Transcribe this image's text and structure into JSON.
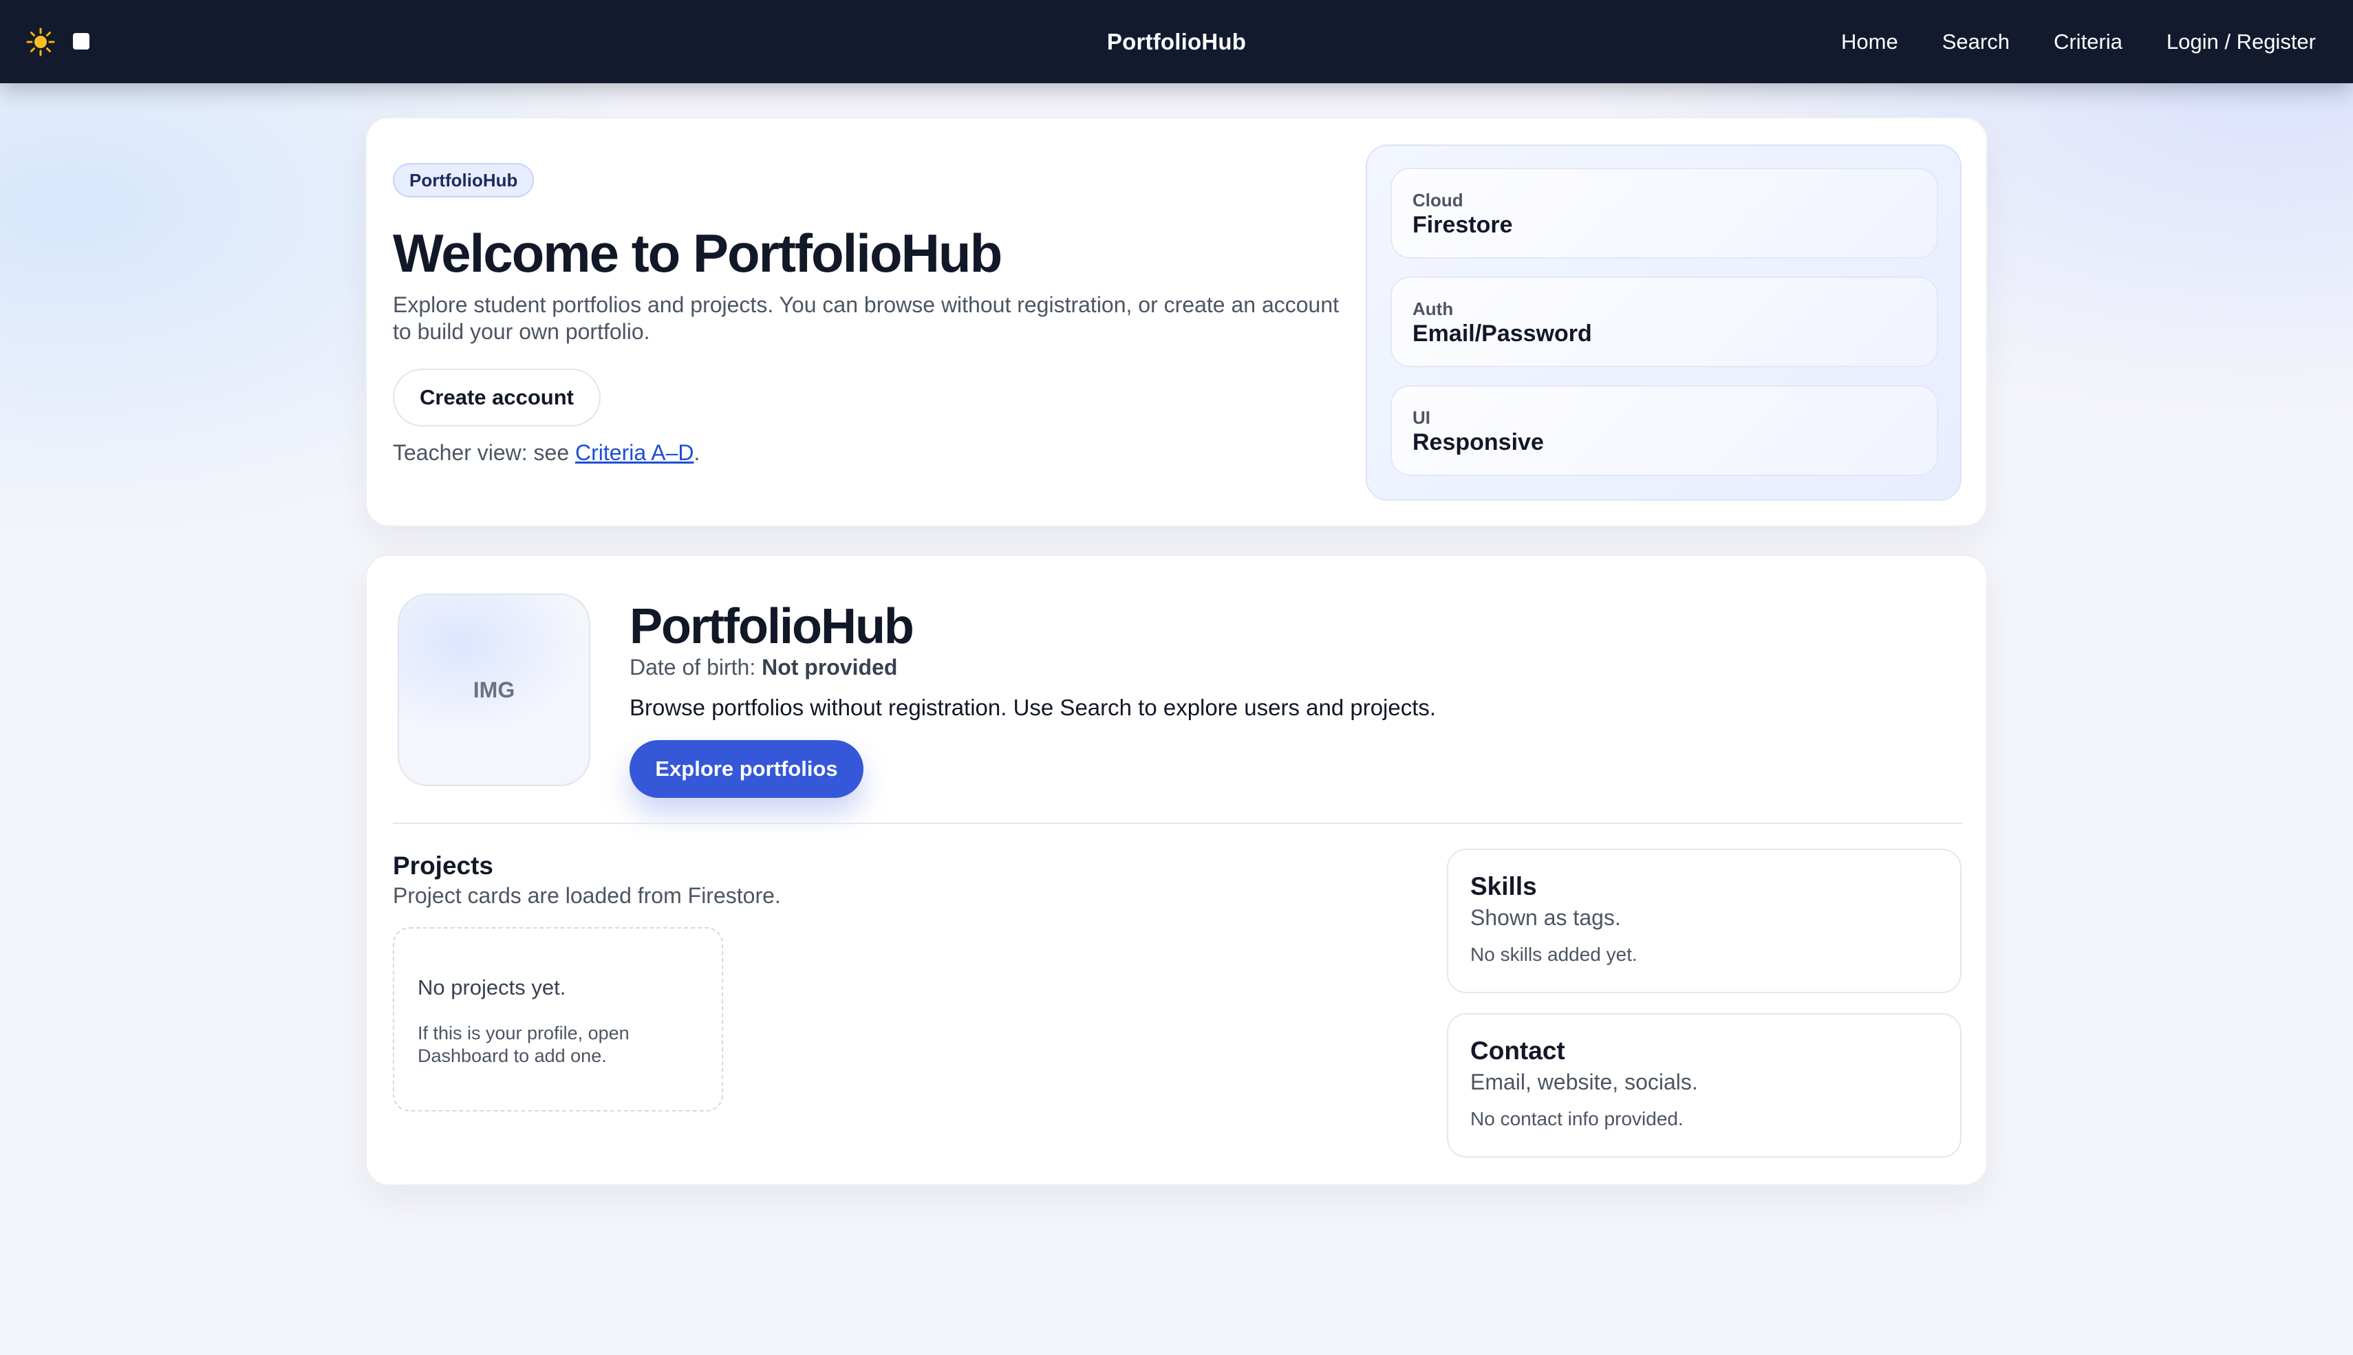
{
  "header": {
    "brand": "PortfolioHub",
    "nav": [
      "Home",
      "Search",
      "Criteria",
      "Login / Register"
    ],
    "theme_icon": "sun-icon",
    "accent": "#141a2e"
  },
  "hero": {
    "pill": "PortfolioHub",
    "title": "Welcome to PortfolioHub",
    "description": "Explore student portfolios and projects. You can browse without registration, or create an account to build your own portfolio.",
    "create_account": "Create account",
    "teacher_prefix": "Teacher view: see ",
    "teacher_link": "Criteria A–D",
    "teacher_suffix": ".",
    "features": [
      {
        "key": "Cloud",
        "value": "Firestore"
      },
      {
        "key": "Auth",
        "value": "Email/Password"
      },
      {
        "key": "UI",
        "value": "Responsive"
      }
    ]
  },
  "profile": {
    "avatar_text": "IMG",
    "name": "PortfolioHub",
    "dob_label": "Date of birth: ",
    "dob_value": "Not provided",
    "bio": "Browse portfolios without registration. Use Search to explore users and projects.",
    "explore_button": "Explore portfolios",
    "primary_color": "#3458d8",
    "projects": {
      "title": "Projects",
      "subtitle": "Project cards are loaded from Firestore.",
      "empty_title": "No projects yet.",
      "empty_hint": "If this is your profile, open Dashboard to add one."
    },
    "skills": {
      "title": "Skills",
      "subtitle": "Shown as tags.",
      "empty": "No skills added yet."
    },
    "contact": {
      "title": "Contact",
      "subtitle": "Email, website, socials.",
      "empty": "No contact info provided."
    }
  }
}
